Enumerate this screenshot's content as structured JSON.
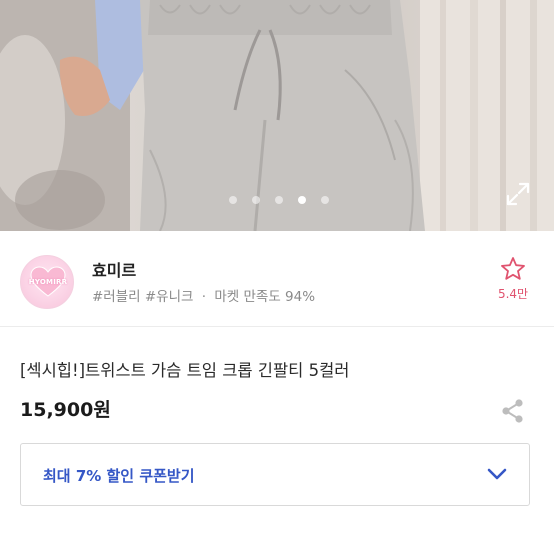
{
  "gallery": {
    "photo_alt": "product-photo",
    "page_count": 5,
    "active_index": 3,
    "expand_icon": "expand-icon"
  },
  "shop": {
    "logo_text": "HYOMIRR",
    "name": "효미르",
    "tag1": "#러블리",
    "tag2": "#유니크",
    "separator": "·",
    "satisfaction": "마켓 만족도 94%",
    "favorite_icon": "star-outline-icon",
    "favorite_count": "5.4만",
    "accent_color": "#e0536f"
  },
  "product": {
    "title": "[섹시힙!]트위스트 가슴 트임 크롭 긴팔티 5컬러",
    "price": "15,900원",
    "share_icon": "share-icon"
  },
  "coupon": {
    "label": "최대 7% 할인 쿠폰받기",
    "chevron_icon": "chevron-down-icon",
    "accent_color": "#3557c6"
  }
}
